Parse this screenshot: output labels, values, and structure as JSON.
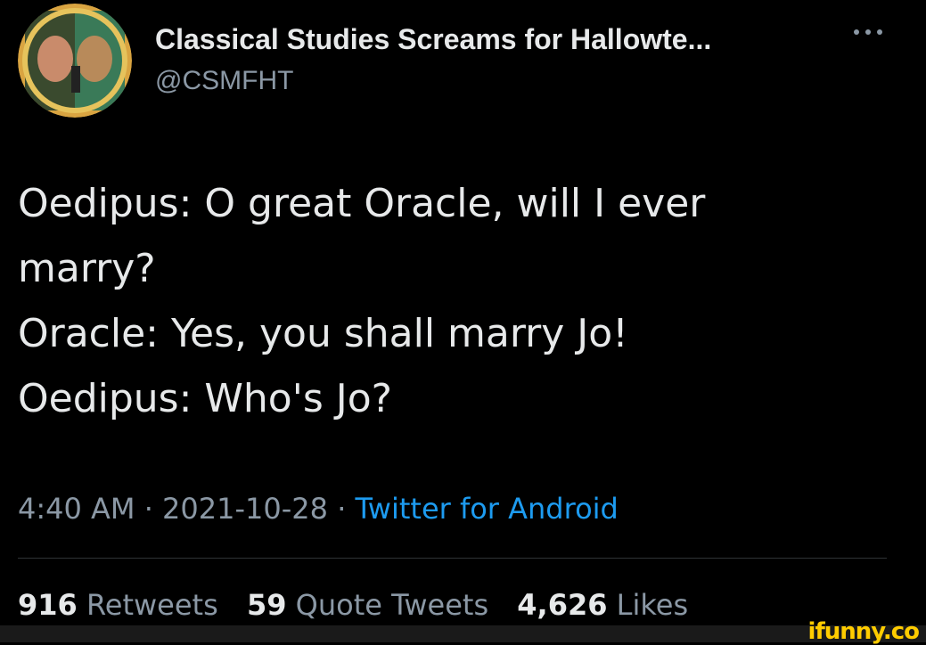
{
  "header": {
    "display_name": "Classical Studies Screams for Hallowte...",
    "handle": "@CSMFHT",
    "more_icon": "more-horizontal-icon"
  },
  "tweet": {
    "lines": [
      "Oedipus: O great Oracle, will I ever",
      "marry?",
      "Oracle: Yes, you shall marry Jo!",
      "Oedipus: Who's Jo?"
    ]
  },
  "meta": {
    "time": "4:40 AM",
    "date": "2021-10-28",
    "separator": "·",
    "source": "Twitter for Android"
  },
  "stats": {
    "retweets_count": "916",
    "retweets_label": "Retweets",
    "quotes_count": "59",
    "quotes_label": "Quote Tweets",
    "likes_count": "4,626",
    "likes_label": "Likes"
  },
  "watermark": "ifunny.co",
  "colors": {
    "background": "#000000",
    "text": "#e7e9ea",
    "secondary": "#8b98a5",
    "link": "#1d9bf0",
    "watermark": "#ffcc00"
  }
}
